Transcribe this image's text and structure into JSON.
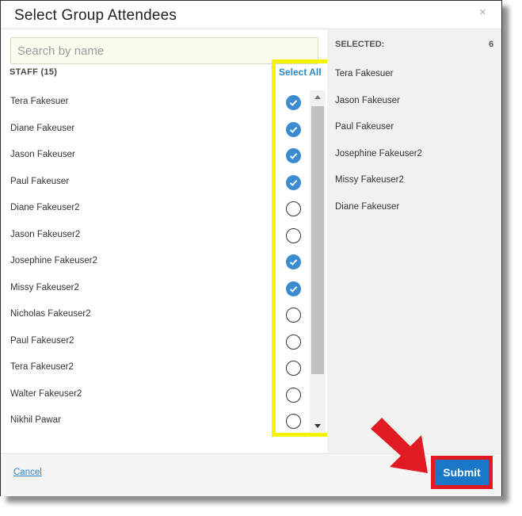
{
  "dialog": {
    "title": "Select Group Attendees",
    "close_symbol": "×"
  },
  "search": {
    "placeholder": "Search by name",
    "value": ""
  },
  "staff": {
    "label": "STAFF (15)",
    "select_all_label": "Select All",
    "items": [
      {
        "name": "Tera Fakesuer",
        "checked": true
      },
      {
        "name": "Diane Fakeuser",
        "checked": true
      },
      {
        "name": "Jason Fakeuser",
        "checked": true
      },
      {
        "name": "Paul Fakeuser",
        "checked": true
      },
      {
        "name": "Diane Fakeuser2",
        "checked": false
      },
      {
        "name": "Jason Fakeuser2",
        "checked": false
      },
      {
        "name": "Josephine Fakeuser2",
        "checked": true
      },
      {
        "name": "Missy Fakeuser2",
        "checked": true
      },
      {
        "name": "Nicholas Fakeuser2",
        "checked": false
      },
      {
        "name": "Paul Fakeuser2",
        "checked": false
      },
      {
        "name": "Tera Fakeuser2",
        "checked": false
      },
      {
        "name": "Walter Fakeuser2",
        "checked": false
      },
      {
        "name": "Nikhil Pawar",
        "checked": false
      }
    ]
  },
  "selected": {
    "label": "SELECTED:",
    "count": "6",
    "items": [
      "Tera Fakesuer",
      "Jason Fakeuser",
      "Paul Fakeuser",
      "Josephine Fakeuser2",
      "Missy Fakeuser2",
      "Diane Fakeuser"
    ]
  },
  "footer": {
    "cancel_label": "Cancel",
    "submit_label": "Submit"
  },
  "colors": {
    "accent": "#2e86c8",
    "checked": "#3a8bcf",
    "submit": "#1a76c6",
    "highlight": "#f7f200",
    "annotation": "#e01b24"
  }
}
